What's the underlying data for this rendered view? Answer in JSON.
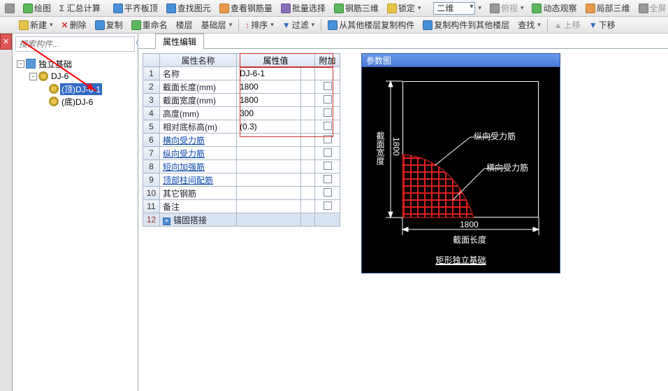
{
  "top_toolbar": {
    "items": [
      {
        "name": "draw",
        "label": "绘图"
      },
      {
        "name": "sigma",
        "label": "Σ 汇总计算"
      },
      {
        "name": "flatroof",
        "label": "平齐板顶"
      },
      {
        "name": "find-unit",
        "label": "查找图元"
      },
      {
        "name": "view-rebar",
        "label": "查看钢筋量"
      },
      {
        "name": "batch-select",
        "label": "批量选择"
      },
      {
        "name": "rebar-3d",
        "label": "钢筋三维"
      },
      {
        "name": "lock",
        "label": "锁定"
      }
    ],
    "two_d": "二维",
    "right": [
      {
        "name": "plan-view",
        "label": "俯视"
      },
      {
        "name": "dyn-observe",
        "label": "动态观察"
      },
      {
        "name": "local-3d",
        "label": "局部三维"
      },
      {
        "name": "fullscreen",
        "label": "全屏"
      }
    ]
  },
  "second_toolbar": {
    "new": "新建",
    "delete": "删除",
    "copy": "复制",
    "rename": "重命名",
    "floor": "楼层",
    "base": "基础层",
    "sort": "排序",
    "filter": "过滤",
    "copyfrom": "从其他楼层复制构件",
    "copyto": "复制构件到其他楼层",
    "find": "查找",
    "up": "上移",
    "down": "下移"
  },
  "search_placeholder": "搜索构件...",
  "tree": {
    "root": "独立基础",
    "l1": "DJ-6",
    "l2a": "(顶)DJ-6-1",
    "l2b": "(底)DJ-6"
  },
  "prop_tab": "属性编辑",
  "grid": {
    "headers": {
      "name": "属性名称",
      "value": "属性值",
      "extra": "附加"
    },
    "rows": [
      {
        "n": "1",
        "name": "名称",
        "val": "DJ-6-1",
        "chk": false
      },
      {
        "n": "2",
        "name": "截面长度(mm)",
        "val": "1800",
        "chk": true
      },
      {
        "n": "3",
        "name": "截面宽度(mm)",
        "val": "1800",
        "chk": true
      },
      {
        "n": "4",
        "name": "高度(mm)",
        "val": "300",
        "chk": true
      },
      {
        "n": "5",
        "name": "相对底标高(m)",
        "val": "(0.3)",
        "chk": true
      },
      {
        "n": "6",
        "name": "横向受力筋",
        "val": "",
        "chk": true,
        "link": true
      },
      {
        "n": "7",
        "name": "纵向受力筋",
        "val": "",
        "chk": true,
        "link": true
      },
      {
        "n": "8",
        "name": "短向加强筋",
        "val": "",
        "chk": true,
        "link": true
      },
      {
        "n": "9",
        "name": "顶部柱间配筋",
        "val": "",
        "chk": true,
        "link": true
      },
      {
        "n": "10",
        "name": "其它钢筋",
        "val": "",
        "chk": true
      },
      {
        "n": "11",
        "name": "备注",
        "val": "",
        "chk": true
      },
      {
        "n": "12",
        "name": "锚固搭接",
        "val": "",
        "chk": false,
        "plus": true
      }
    ]
  },
  "param": {
    "title": "参数图",
    "dim_w": "1800",
    "dim_h": "1800",
    "dim_w_lbl": "截面长度",
    "dim_h_lbl": "截面宽度",
    "lbl_v": "纵向受力筋",
    "lbl_h": "横向受力筋",
    "figure_title": "矩形独立基础"
  },
  "chart_data": {
    "type": "diagram",
    "shape": "rectangular_independent_foundation",
    "plan_width_mm": 1800,
    "plan_height_mm": 1800,
    "annotations": [
      "纵向受力筋",
      "横向受力筋"
    ],
    "title": "矩形独立基础"
  }
}
